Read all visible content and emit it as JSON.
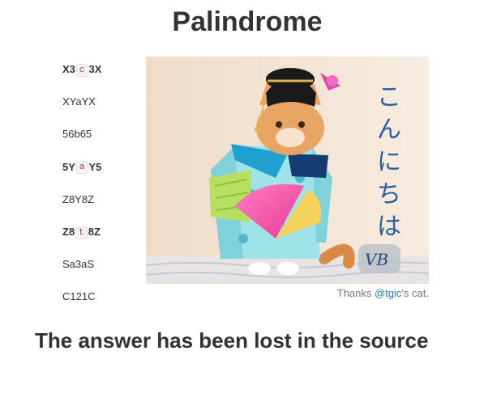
{
  "page": {
    "title": "Palindrome"
  },
  "palindromes": [
    {
      "before": "X3",
      "highlight": "c",
      "after": "3X"
    },
    {
      "before": "XYaYX",
      "highlight": "",
      "after": ""
    },
    {
      "before": "56b65",
      "highlight": "",
      "after": ""
    },
    {
      "before": "5Y",
      "highlight": "a",
      "after": "Y5"
    },
    {
      "before": "Z8Y8Z",
      "highlight": "",
      "after": ""
    },
    {
      "before": "Z8",
      "highlight": "t",
      "after": "8Z"
    },
    {
      "before": "Sa3aS",
      "highlight": "",
      "after": ""
    },
    {
      "before": "C121C",
      "highlight": "",
      "after": ""
    }
  ],
  "image": {
    "caption_text": "こんにちは",
    "signature": "VB",
    "description_icon": "geisha-cat-image"
  },
  "credit": {
    "prefix": "Thanks ",
    "link": "@tgic",
    "suffix": "'s cat."
  },
  "footer": {
    "answer_text": "The answer has been lost in the source"
  },
  "colors": {
    "link": "#2a7ab0",
    "code": "#c7254e",
    "text": "#333333"
  }
}
